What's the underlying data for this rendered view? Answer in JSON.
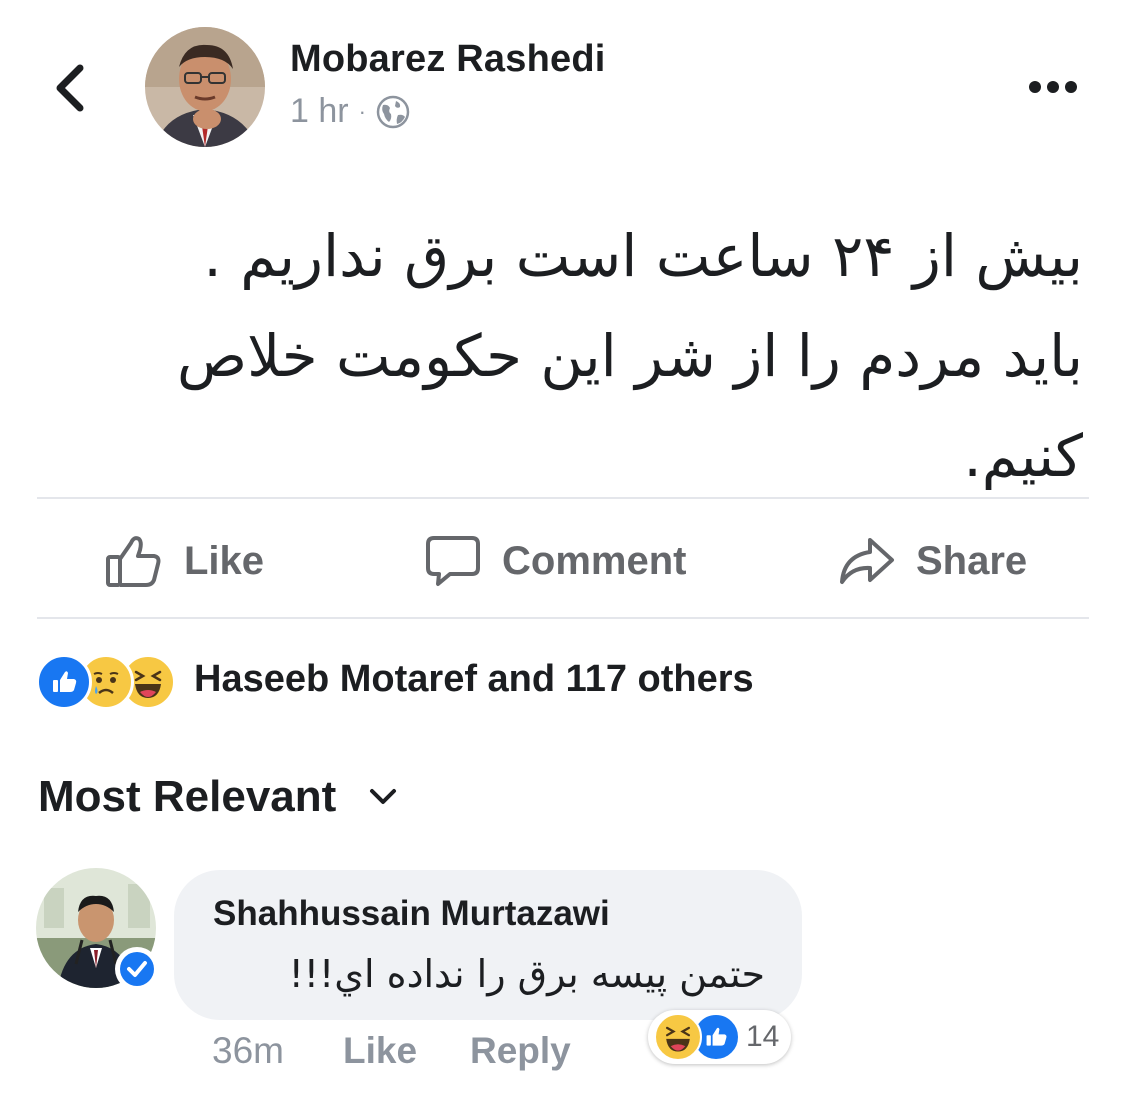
{
  "post": {
    "author": "Mobarez Rashedi",
    "time": "1 hr",
    "separator": "·",
    "privacy_icon": "globe-icon",
    "text_lines": [
      "بیش از ۲۴ ساعت است برق نداریم .",
      "باید مردم را از شر این حکومت خلاص",
      "کنیم."
    ]
  },
  "actions": {
    "like": "Like",
    "comment": "Comment",
    "share": "Share"
  },
  "reactions": {
    "icons": [
      "like-icon",
      "sad-icon",
      "haha-icon"
    ],
    "summary": "Haseeb Motaref and 117 others"
  },
  "sort": {
    "label": "Most Relevant"
  },
  "comment": {
    "author": "Shahhussain Murtazawi",
    "verified": true,
    "text": "حتمن پیسه برق را نداده اي!!!",
    "time": "36m",
    "like_label": "Like",
    "reply_label": "Reply",
    "reaction_icons": [
      "haha-icon",
      "like-icon"
    ],
    "reaction_count": "14"
  },
  "colors": {
    "text": "#1c1e21",
    "secondary": "#65676b",
    "muted": "#8d949e",
    "like_blue": "#1877f2",
    "bubble": "#f0f2f5",
    "divider": "#e4e6eb",
    "emoji_yellow": "#f7c843"
  }
}
